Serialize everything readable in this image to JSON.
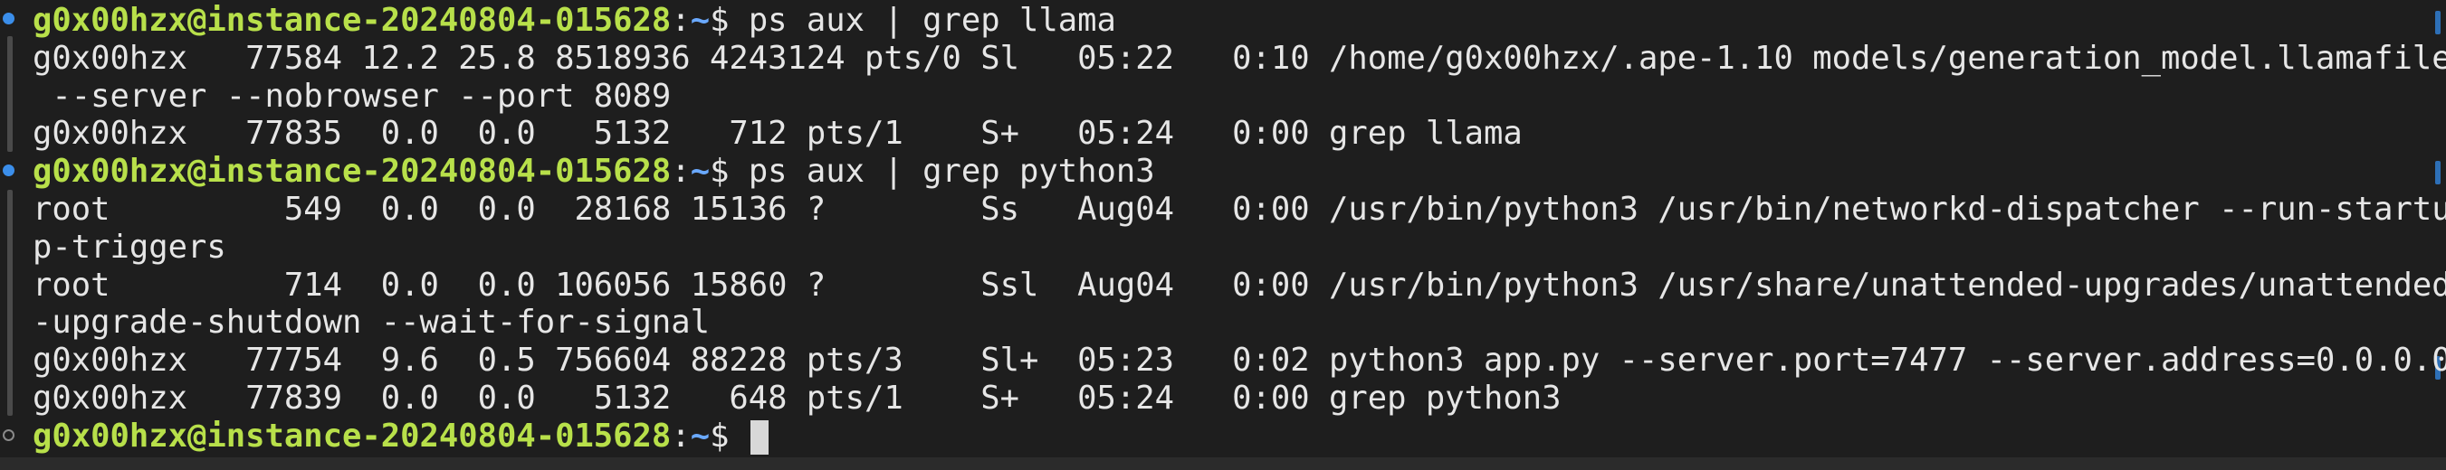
{
  "terminal": {
    "user_host": "g0x00hzx@instance-20240804-015628",
    "separator": ":",
    "path": "~",
    "prompt_symbol": "$ ",
    "cmd1": "ps aux | grep llama",
    "out1": [
      "g0x00hzx   77584 12.2 25.8 8518936 4243124 pts/0 Sl   05:22   0:10 /home/g0x00hzx/.ape-1.10 models/generation_model.llamafile",
      " --server --nobrowser --port 8089",
      "g0x00hzx   77835  0.0  0.0   5132   712 pts/1    S+   05:24   0:00 grep llama"
    ],
    "cmd2": "ps aux | grep python3",
    "out2": [
      "root         549  0.0  0.0  28168 15136 ?        Ss   Aug04   0:00 /usr/bin/python3 /usr/bin/networkd-dispatcher --run-startu",
      "p-triggers",
      "root         714  0.0  0.0 106056 15860 ?        Ssl  Aug04   0:00 /usr/bin/python3 /usr/share/unattended-upgrades/unattended",
      "-upgrade-shutdown --wait-for-signal",
      "g0x00hzx   77754  9.6  0.5 756604 88228 pts/3    Sl+  05:23   0:02 python3 app.py --server.port=7477 --server.address=0.0.0.0",
      "g0x00hzx   77839  0.0  0.0   5132   648 pts/1    S+   05:24   0:00 grep python3"
    ]
  },
  "colors": {
    "background": "#1e1e1e",
    "prompt_user": "#b8e04a",
    "prompt_path": "#6aa9ff",
    "text": "#e6e6e6"
  }
}
